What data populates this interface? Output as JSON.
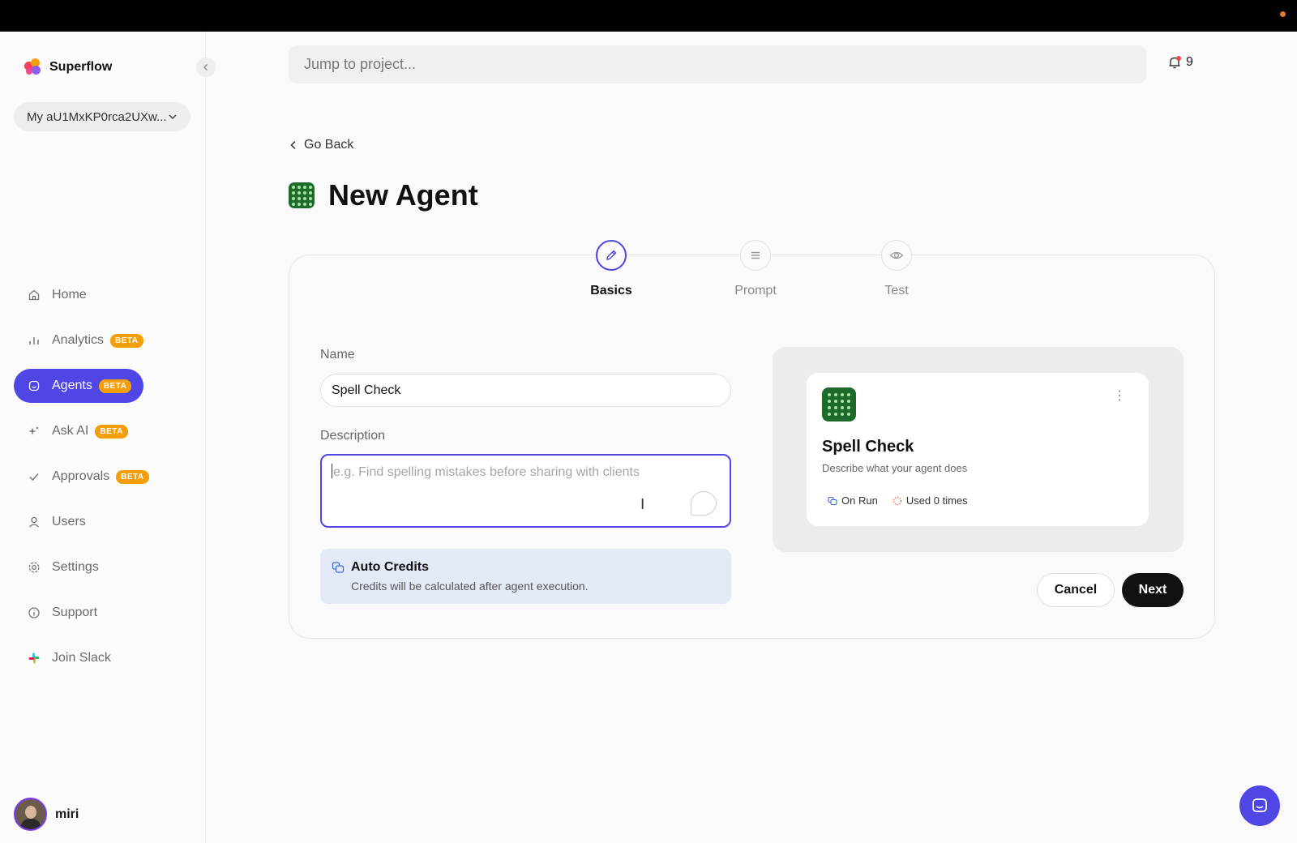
{
  "app": {
    "name": "Superflow"
  },
  "workspace": {
    "label": "My aU1MxKP0rca2UXw..."
  },
  "nav": {
    "items": [
      {
        "label": "Home",
        "icon": "home-icon"
      },
      {
        "label": "Analytics",
        "icon": "bar-chart-icon",
        "badge": "BETA"
      },
      {
        "label": "Agents",
        "icon": "agent-icon",
        "badge": "BETA",
        "active": true
      },
      {
        "label": "Ask AI",
        "icon": "sparkle-icon",
        "badge": "BETA"
      },
      {
        "label": "Approvals",
        "icon": "check-icon",
        "badge": "BETA"
      },
      {
        "label": "Users",
        "icon": "user-icon"
      },
      {
        "label": "Settings",
        "icon": "gear-icon"
      },
      {
        "label": "Support",
        "icon": "info-icon"
      },
      {
        "label": "Join Slack",
        "icon": "slack-icon"
      }
    ]
  },
  "user": {
    "name": "miri"
  },
  "search": {
    "placeholder": "Jump to project..."
  },
  "notifications": {
    "count": "9"
  },
  "page": {
    "back_label": "Go Back",
    "title": "New Agent"
  },
  "steps": [
    {
      "label": "Basics",
      "icon": "pencil-icon",
      "active": true
    },
    {
      "label": "Prompt",
      "icon": "lines-icon"
    },
    {
      "label": "Test",
      "icon": "eye-icon"
    }
  ],
  "form": {
    "name_label": "Name",
    "name_value": "Spell Check",
    "description_label": "Description",
    "description_placeholder": "e.g. Find spelling mistakes before sharing with clients",
    "description_value": ""
  },
  "credits": {
    "title": "Auto Credits",
    "subtitle": "Credits will be calculated after agent execution."
  },
  "preview": {
    "title": "Spell Check",
    "description": "Describe what your agent does",
    "trigger": "On Run",
    "usage": "Used 0 times"
  },
  "actions": {
    "cancel_label": "Cancel",
    "next_label": "Next"
  },
  "colors": {
    "accent": "#4f46e5",
    "badge": "#f59e0b",
    "agent_icon_bg": "#1f6b2b",
    "credits_bg": "#e3e9f7"
  }
}
